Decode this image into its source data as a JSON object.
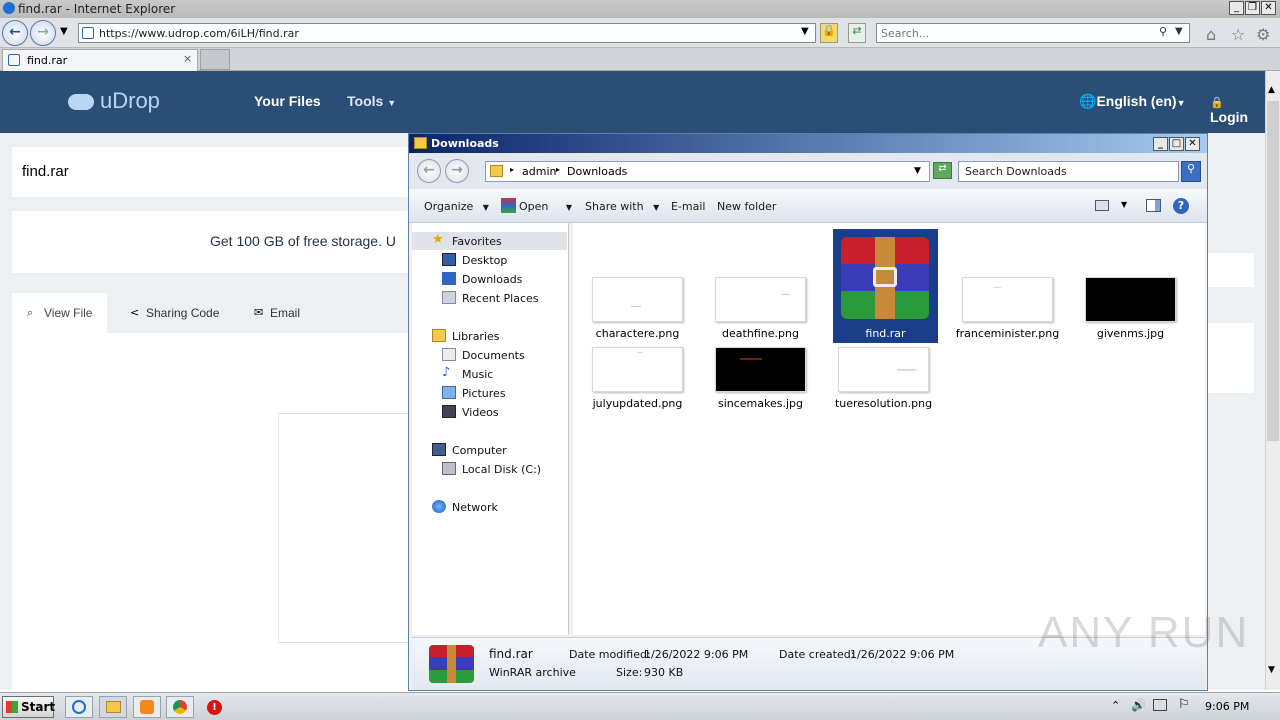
{
  "ie": {
    "window_title": "find.rar - Internet Explorer",
    "url": "https://www.udrop.com/6iLH/find.rar",
    "search_placeholder": "Search...",
    "tab_label": "find.rar",
    "tab_close": "×"
  },
  "site": {
    "logo": "uDrop",
    "nav": [
      "Your Files",
      "Tools"
    ],
    "language": "English (en)",
    "login": "Login",
    "file_title": "find.rar",
    "promo": "Get 100 GB of free storage. U",
    "tabs": [
      "View File",
      "Sharing Code",
      "Email"
    ]
  },
  "explorer": {
    "title": "Downloads",
    "breadcrumb": [
      "admin",
      "Downloads"
    ],
    "search_placeholder": "Search Downloads",
    "toolbar": [
      "Organize",
      "Open",
      "Share with",
      "E-mail",
      "New folder"
    ],
    "nav": {
      "favorites": {
        "label": "Favorites",
        "items": [
          "Desktop",
          "Downloads",
          "Recent Places"
        ]
      },
      "libraries": {
        "label": "Libraries",
        "items": [
          "Documents",
          "Music",
          "Pictures",
          "Videos"
        ]
      },
      "computer": {
        "label": "Computer",
        "items": [
          "Local Disk (C:)"
        ]
      },
      "network": {
        "label": "Network"
      }
    },
    "files": [
      {
        "name": "charactere.png"
      },
      {
        "name": "deathfine.png"
      },
      {
        "name": "find.rar"
      },
      {
        "name": "franceminister.png"
      },
      {
        "name": "givenms.jpg"
      },
      {
        "name": "julyupdated.png"
      },
      {
        "name": "sincemakes.jpg"
      },
      {
        "name": "tueresolution.png"
      }
    ],
    "details": {
      "name": "find.rar",
      "type": "WinRAR archive",
      "modified_label": "Date modified:",
      "modified": "1/26/2022 9:06 PM",
      "created_label": "Date created:",
      "created": "1/26/2022 9:06 PM",
      "size_label": "Size:",
      "size": "930 KB"
    }
  },
  "taskbar": {
    "start": "Start",
    "clock": "9:06 PM"
  },
  "watermark": "ANY RUN",
  "colors": {
    "site_header": "#2b4e77",
    "selection": "#1a3e8a"
  }
}
